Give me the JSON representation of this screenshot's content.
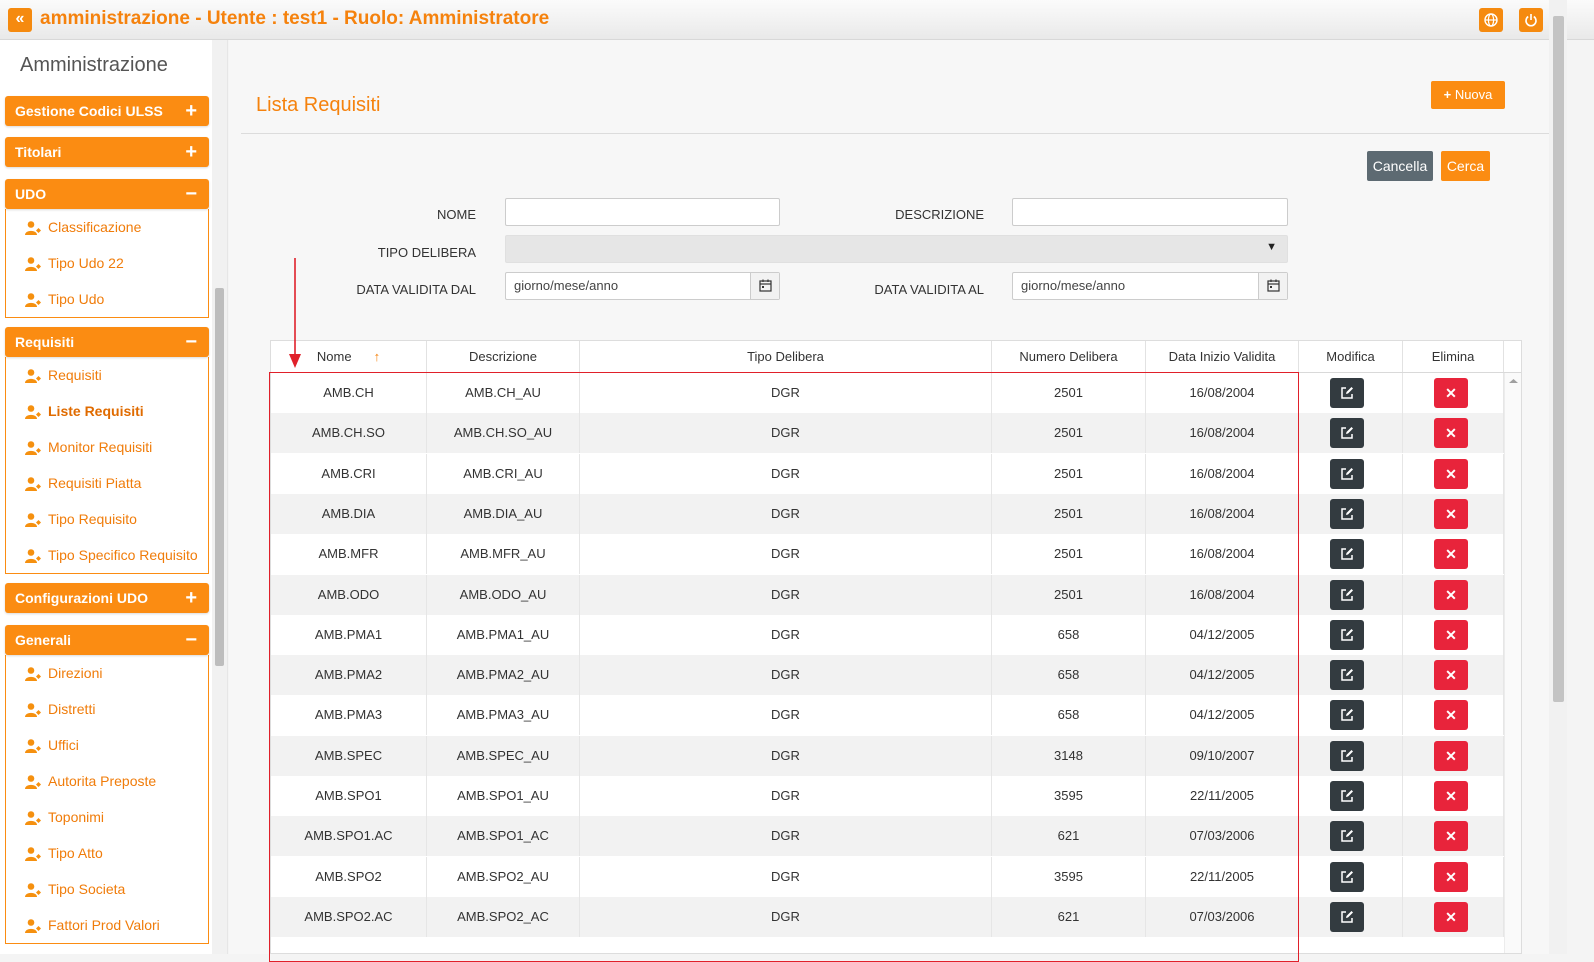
{
  "topbar": {
    "back_icon": "double-chevron-left-icon",
    "title": "amministrazione - Utente : test1 - Ruolo: Amministratore",
    "icons": [
      "globe-icon",
      "power-icon"
    ]
  },
  "sidebar": {
    "heading": "Amministrazione",
    "groups": [
      {
        "label": "Gestione Codici ULSS",
        "toggle": "+",
        "items": []
      },
      {
        "label": "Titolari",
        "toggle": "+",
        "items": []
      },
      {
        "label": "UDO",
        "toggle": "−",
        "items": [
          "Classificazione",
          "Tipo Udo 22",
          "Tipo Udo"
        ]
      },
      {
        "label": "Requisiti",
        "toggle": "−",
        "items": [
          "Requisiti",
          "Liste Requisiti",
          "Monitor Requisiti",
          "Requisiti Piatta",
          "Tipo Requisito",
          "Tipo Specifico Requisito"
        ]
      },
      {
        "label": "Configurazioni UDO",
        "toggle": "+",
        "items": []
      },
      {
        "label": "Generali",
        "toggle": "−",
        "items": [
          "Direzioni",
          "Distretti",
          "Uffici",
          "Autorita Preposte",
          "Toponimi",
          "Tipo Atto",
          "Tipo Societa",
          "Fattori Prod Valori"
        ]
      }
    ],
    "active_item": "Liste Requisiti"
  },
  "main": {
    "title": "Lista Requisiti",
    "new_button": "Nuova",
    "cancel_button": "Cancella",
    "search_button": "Cerca",
    "filters": {
      "nome_label": "NOME",
      "nome_value": "",
      "descrizione_label": "DESCRIZIONE",
      "descrizione_value": "",
      "tipo_delibera_label": "TIPO DELIBERA",
      "tipo_delibera_value": "",
      "data_dal_label": "DATA VALIDITA DAL",
      "data_dal_placeholder": "giorno/mese/anno",
      "data_al_label": "DATA VALIDITA AL",
      "data_al_placeholder": "giorno/mese/anno"
    }
  },
  "table": {
    "columns": [
      "Nome",
      "Descrizione",
      "Tipo Delibera",
      "Numero Delibera",
      "Data Inizio Validita",
      "Modifica",
      "Elimina"
    ],
    "sort_column": "Nome",
    "sort_icon": "sort-ascending-arrow-icon",
    "rows": [
      [
        "AMB.CH",
        "AMB.CH_AU",
        "DGR",
        "2501",
        "16/08/2004"
      ],
      [
        "AMB.CH.SO",
        "AMB.CH.SO_AU",
        "DGR",
        "2501",
        "16/08/2004"
      ],
      [
        "AMB.CRI",
        "AMB.CRI_AU",
        "DGR",
        "2501",
        "16/08/2004"
      ],
      [
        "AMB.DIA",
        "AMB.DIA_AU",
        "DGR",
        "2501",
        "16/08/2004"
      ],
      [
        "AMB.MFR",
        "AMB.MFR_AU",
        "DGR",
        "2501",
        "16/08/2004"
      ],
      [
        "AMB.ODO",
        "AMB.ODO_AU",
        "DGR",
        "2501",
        "16/08/2004"
      ],
      [
        "AMB.PMA1",
        "AMB.PMA1_AU",
        "DGR",
        "658",
        "04/12/2005"
      ],
      [
        "AMB.PMA2",
        "AMB.PMA2_AU",
        "DGR",
        "658",
        "04/12/2005"
      ],
      [
        "AMB.PMA3",
        "AMB.PMA3_AU",
        "DGR",
        "658",
        "04/12/2005"
      ],
      [
        "AMB.SPEC",
        "AMB.SPEC_AU",
        "DGR",
        "3148",
        "09/10/2007"
      ],
      [
        "AMB.SPO1",
        "AMB.SPO1_AU",
        "DGR",
        "3595",
        "22/11/2005"
      ],
      [
        "AMB.SPO1.AC",
        "AMB.SPO1_AC",
        "DGR",
        "621",
        "07/03/2006"
      ],
      [
        "AMB.SPO2",
        "AMB.SPO2_AU",
        "DGR",
        "3595",
        "22/11/2005"
      ],
      [
        "AMB.SPO2.AC",
        "AMB.SPO2_AC",
        "DGR",
        "621",
        "07/03/2006"
      ]
    ]
  },
  "colors": {
    "accent": "#fb8c12",
    "title": "#f5820d",
    "edit_button": "#333b40",
    "delete_button": "#e8243b",
    "annotation": "#e0202a"
  }
}
